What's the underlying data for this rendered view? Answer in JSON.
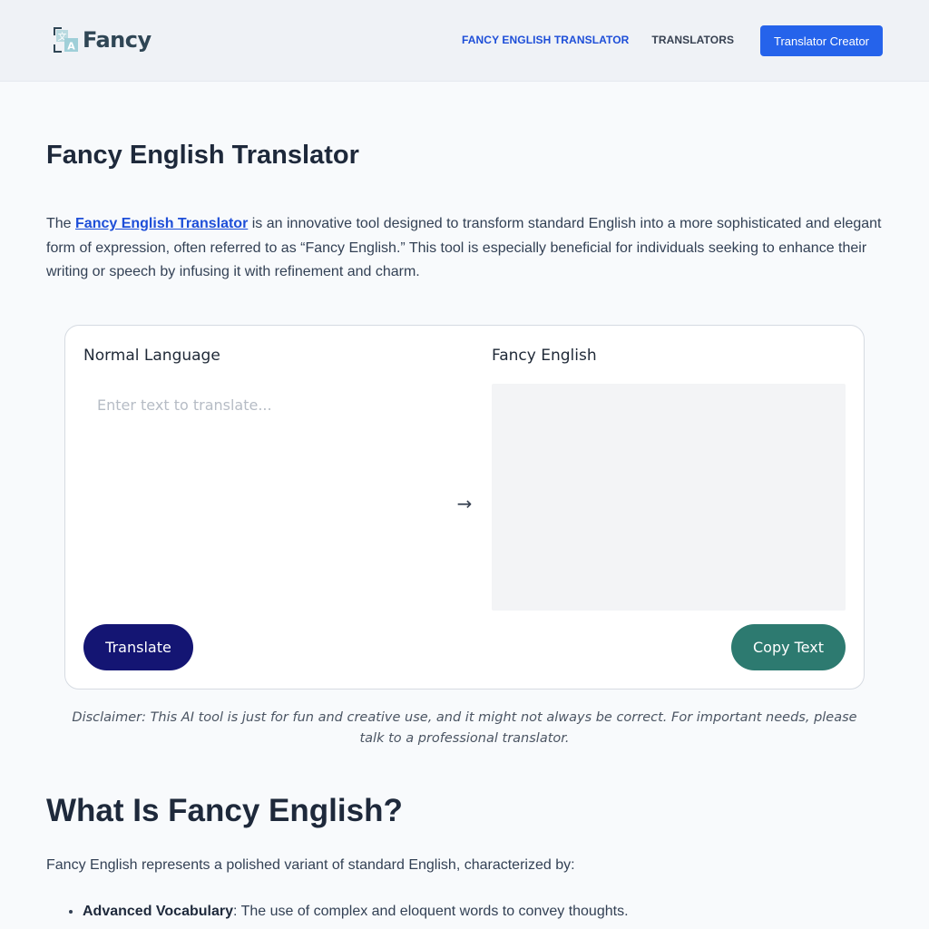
{
  "header": {
    "logo_text": "Fancy",
    "nav": [
      {
        "label": "FANCY ENGLISH TRANSLATOR",
        "active": true
      },
      {
        "label": "TRANSLATORS",
        "active": false
      }
    ],
    "cta_label": "Translator Creator"
  },
  "main": {
    "title": "Fancy English Translator",
    "intro": {
      "prefix": "The ",
      "link_text": "Fancy English Translator",
      "suffix": " is an innovative tool designed to transform standard English into a more sophisticated and elegant form of expression, often referred to as “Fancy English.” This tool is especially beneficial for individuals seeking to enhance their writing or speech by infusing it with refinement and charm."
    }
  },
  "translator": {
    "source_label": "Normal Language",
    "target_label": "Fancy English",
    "input_value": "",
    "input_placeholder": "Enter text to translate...",
    "arrow_glyph": "→",
    "output_value": "",
    "translate_label": "Translate",
    "copy_label": "Copy Text"
  },
  "disclaimer": "Disclaimer: This AI tool is just for fun and creative use, and it might not always be correct. For important needs, please talk to a professional translator.",
  "section": {
    "title": "What Is Fancy English?",
    "intro": "Fancy English represents a polished variant of standard English, characterized by:",
    "features": [
      {
        "term": "Advanced Vocabulary",
        "desc": ": The use of complex and eloquent words to convey thoughts."
      }
    ]
  },
  "colors": {
    "accent": "#2563eb",
    "translate_button": "#141573",
    "copy_button": "#2d7a70",
    "header_bg": "#eff2f6"
  },
  "icons": {
    "logo": "translate-icon",
    "arrow": "arrow-right-icon"
  }
}
